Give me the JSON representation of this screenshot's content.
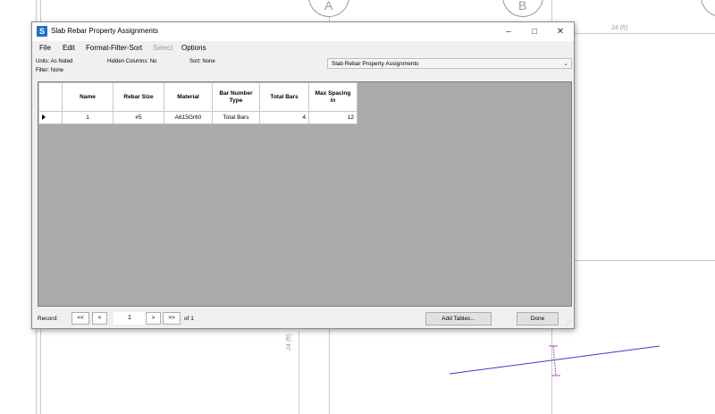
{
  "background": {
    "grid_bubbles": [
      "A",
      "B"
    ],
    "dimension_labels": [
      "24 (ft)",
      "24 (ft)"
    ]
  },
  "dialog": {
    "title": "Slab Rebar Property Assignments",
    "app_icon": "S",
    "menu": [
      "File",
      "Edit",
      "Format-Filter-Sort",
      "Select",
      "Options"
    ],
    "menu_disabled": [
      "Select"
    ],
    "units_label": "Units:",
    "units_value": "As Noted",
    "hidden_columns_label": "Hidden Columns:",
    "hidden_columns_value": "No",
    "sort_label": "Sort:",
    "sort_value": "None",
    "filter_label": "Filter:",
    "filter_value": "None",
    "table_selector": "Slab Rebar Property Assignments",
    "table": {
      "columns": [
        "Name",
        "Rebar Size",
        "Material",
        "Bar Number Type",
        "Total Bars",
        "Max Spacing in"
      ],
      "rows": [
        [
          "1",
          "#5",
          "A615Gr60",
          "Total Bars",
          "4",
          "12"
        ]
      ]
    },
    "record": {
      "label": "Record:",
      "first": "<<",
      "prev": "<",
      "current": "1",
      "next": ">",
      "last": ">>",
      "of_text": "of 1"
    },
    "add_tables_label": "Add Tables...",
    "done_label": "Done"
  },
  "colors": {
    "grid_background": "#ababab",
    "app_icon": "#1a73c9",
    "beam_line": "#3b3bcc",
    "annotation": "#b040c0"
  },
  "icons": [
    "app-icon",
    "minimize-icon",
    "maximize-icon",
    "close-icon",
    "dropdown-chevron-icon",
    "row-selector-icon",
    "resize-grip-icon"
  ]
}
